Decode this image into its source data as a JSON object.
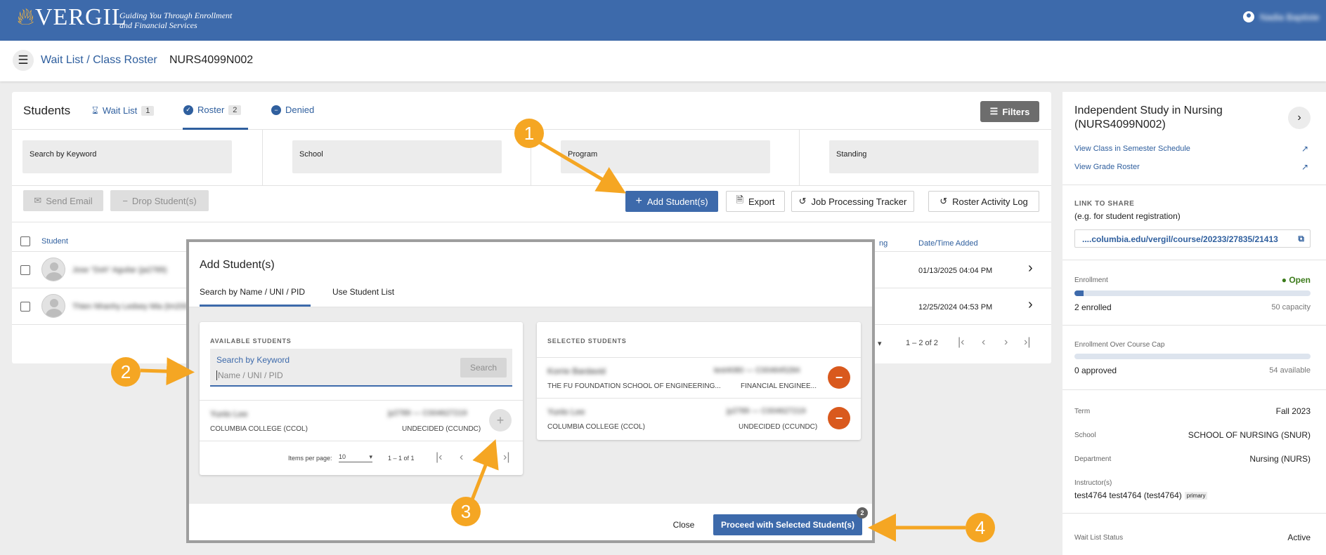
{
  "header": {
    "logo_text": "VERGIL",
    "tagline_line1": "Guiding You Through Enrollment",
    "tagline_line2": "and Financial Services",
    "user_name": "Nadia Baptiste"
  },
  "breadcrumb": {
    "menu_icon": "hamburger-icon",
    "link": "Wait List / Class Roster",
    "course_code": "NURS4099N002"
  },
  "students_panel": {
    "title": "Students",
    "tabs": [
      {
        "label": "Wait List",
        "count": "1",
        "icon": "hourglass-icon"
      },
      {
        "label": "Roster",
        "count": "2",
        "icon": "check-circle-icon"
      },
      {
        "label": "Denied",
        "count": "",
        "icon": "minus-circle-icon"
      }
    ],
    "filters_label": "Filters",
    "filter_fields": [
      "Search by Keyword",
      "School",
      "Program",
      "Standing"
    ],
    "actions": {
      "send_email": "Send Email",
      "drop_students": "Drop Student(s)",
      "add_students": "Add Student(s)",
      "export": "Export",
      "job_tracker": "Job Processing Tracker",
      "activity_log": "Roster Activity Log"
    },
    "columns": {
      "student": "Student",
      "standing_partial": "ng",
      "date_added": "Date/Time Added"
    },
    "rows": [
      {
        "name": "Jose \"Doh\" Aguilar (ja2789)",
        "date": "01/13/2025 04:04 PM"
      },
      {
        "name": "Thien Nhanhy Ledsey Mia (tm2001)",
        "date": "12/25/2024 04:53 PM"
      }
    ],
    "pager": {
      "range": "1 – 2 of 2"
    }
  },
  "sidebar": {
    "course_title": "Independent Study in Nursing (NURS4099N002)",
    "view_schedule": "View Class in Semester Schedule",
    "view_grade_roster": "View Grade Roster",
    "link_to_share_label": "LINK TO SHARE",
    "link_to_share_hint": "(e.g. for student registration)",
    "share_url": "....columbia.edu/vergil/course/20233/27835/21413",
    "enrollment_label": "Enrollment",
    "enrollment_status": "Open",
    "enrolled": "2 enrolled",
    "capacity": "50 capacity",
    "enrollment_fraction": 0.04,
    "over_cap_label": "Enrollment Over Course Cap",
    "approved": "0 approved",
    "available": "54 available",
    "over_cap_fraction": 0,
    "details": [
      {
        "label": "Term",
        "value": "Fall 2023"
      },
      {
        "label": "School",
        "value": "SCHOOL OF NURSING (SNUR)"
      },
      {
        "label": "Department",
        "value": "Nursing (NURS)"
      }
    ],
    "instructors_label": "Instructor(s)",
    "instructor": "test4764 test4764 (test4764)",
    "instructor_role": "primary",
    "waitlist_label": "Wait List Status",
    "waitlist_value": "Active"
  },
  "modal": {
    "title": "Add Student(s)",
    "tab_search": "Search by Name / UNI / PID",
    "tab_list": "Use Student List",
    "available_heading": "AVAILABLE STUDENTS",
    "selected_heading": "SELECTED STUDENTS",
    "search_label": "Search by Keyword",
    "search_placeholder": "Name / UNI / PID",
    "search_button": "Search",
    "available": [
      {
        "name": "Yunlo Lee",
        "id": "jy2789 — C004627219",
        "school": "COLUMBIA COLLEGE (CCOL)",
        "program": "UNDECIDED (CCUNDC)"
      }
    ],
    "selected": [
      {
        "name": "Korrie Bardavid",
        "id": "test4080 — C004645284",
        "school": "THE FU FOUNDATION SCHOOL OF ENGINEERING...",
        "program": "FINANCIAL ENGINEE..."
      },
      {
        "name": "Yunlo Lee",
        "id": "jy2789 — C004627219",
        "school": "COLUMBIA COLLEGE (CCOL)",
        "program": "UNDECIDED (CCUNDC)"
      }
    ],
    "items_per_page_label": "Items per page:",
    "items_per_page": "10",
    "page_range": "1 – 1 of 1",
    "close_button": "Close",
    "proceed_button": "Proceed with Selected Student(s)",
    "proceed_count": "2"
  },
  "annotations": [
    "1",
    "2",
    "3",
    "4"
  ],
  "colors": {
    "brand": "#3d6aab",
    "marker": "#f5a623",
    "remove": "#d9591d",
    "open": "#3b7a1a"
  }
}
